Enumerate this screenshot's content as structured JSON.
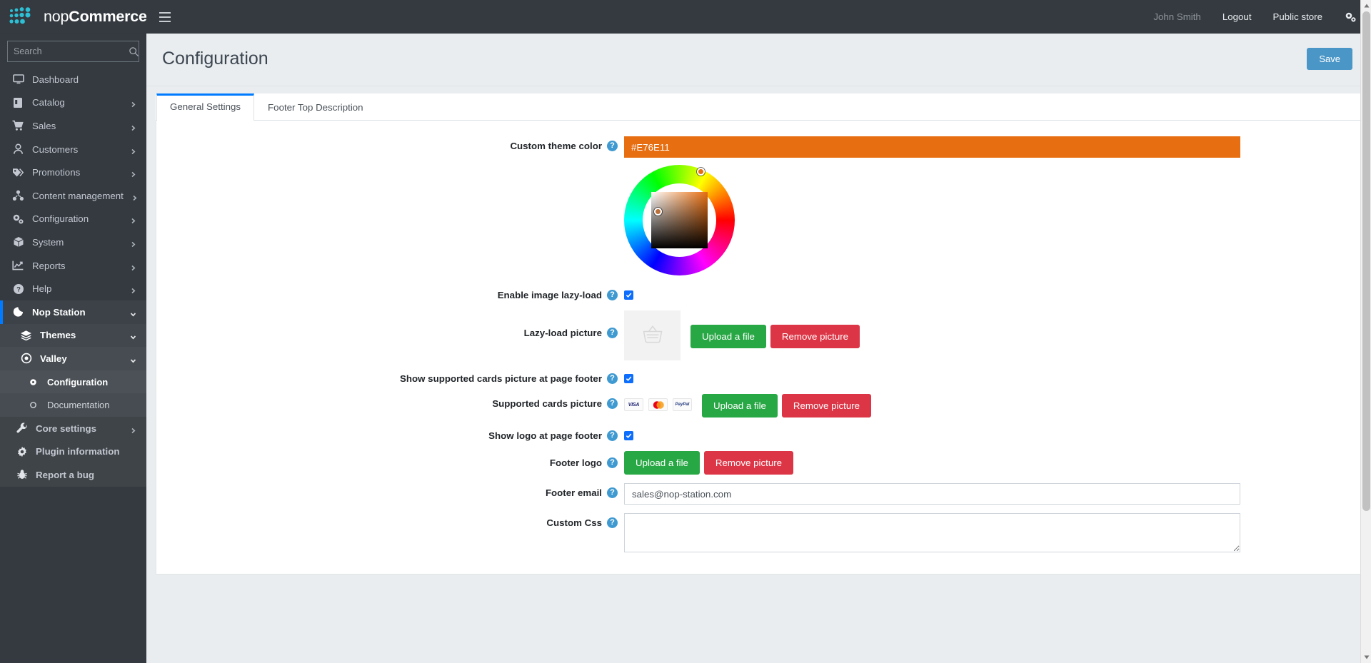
{
  "brand": {
    "name_light": "nop",
    "name_bold": "Commerce",
    "logo_icon": "nopcommerce-dots-logo"
  },
  "search": {
    "placeholder": "Search",
    "value": "",
    "icon": "search-icon"
  },
  "sidebar": {
    "items": [
      {
        "label": "Dashboard",
        "icon": "monitor-icon",
        "has_children": false,
        "level": 1
      },
      {
        "label": "Catalog",
        "icon": "book-icon",
        "has_children": true,
        "level": 1
      },
      {
        "label": "Sales",
        "icon": "shopping-cart-icon",
        "has_children": true,
        "level": 1
      },
      {
        "label": "Customers",
        "icon": "user-icon",
        "has_children": true,
        "level": 1
      },
      {
        "label": "Promotions",
        "icon": "tags-icon",
        "has_children": true,
        "level": 1
      },
      {
        "label": "Content management",
        "icon": "sitemap-icon",
        "has_children": true,
        "level": 1
      },
      {
        "label": "Configuration",
        "icon": "cogs-icon",
        "has_children": true,
        "level": 1
      },
      {
        "label": "System",
        "icon": "cube-icon",
        "has_children": true,
        "level": 1
      },
      {
        "label": "Reports",
        "icon": "chart-line-icon",
        "has_children": true,
        "level": 1
      },
      {
        "label": "Help",
        "icon": "question-circle-icon",
        "has_children": true,
        "level": 1
      },
      {
        "label": "Nop Station",
        "icon": "nop-station-icon",
        "has_children": true,
        "level": 1,
        "active": true
      },
      {
        "label": "Themes",
        "icon": "layers-icon",
        "has_children": true,
        "level": 2
      },
      {
        "label": "Valley",
        "icon": "dot-circle-icon",
        "has_children": true,
        "level": 3
      },
      {
        "label": "Configuration",
        "icon": "circle-small-icon",
        "has_children": false,
        "level": 4,
        "selected": true
      },
      {
        "label": "Documentation",
        "icon": "circle-outline-icon",
        "has_children": false,
        "level": 4
      },
      {
        "label": "Core settings",
        "icon": "wrench-icon",
        "has_children": true,
        "level": 2
      },
      {
        "label": "Plugin information",
        "icon": "gear-icon",
        "has_children": false,
        "level": 2
      },
      {
        "label": "Report a bug",
        "icon": "bug-icon",
        "has_children": false,
        "level": 2
      }
    ]
  },
  "topbar": {
    "menu_toggle_icon": "hamburger-icon",
    "user_name": "John Smith",
    "logout_label": "Logout",
    "public_store_label": "Public store",
    "settings_icon": "cogs-icon"
  },
  "page": {
    "title": "Configuration",
    "save_label": "Save"
  },
  "tabs": [
    {
      "label": "General Settings",
      "active": true
    },
    {
      "label": "Footer Top Description",
      "active": false
    }
  ],
  "form": {
    "theme_color": {
      "label": "Custom theme color",
      "value": "#E76E11",
      "help_icon": "question-circle-icon",
      "picker": {
        "hue_marker_color": "#E76E11",
        "sv_marker_color": "#B9703A"
      }
    },
    "lazy_load_enable": {
      "label": "Enable image lazy-load",
      "checked": true,
      "help_icon": "question-circle-icon"
    },
    "lazy_load_picture": {
      "label": "Lazy-load picture",
      "help_icon": "question-circle-icon",
      "thumb_icon": "basket-placeholder-icon",
      "upload_label": "Upload a file",
      "remove_label": "Remove picture"
    },
    "show_cards_footer": {
      "label": "Show supported cards picture at page footer",
      "checked": true,
      "help_icon": "question-circle-icon"
    },
    "supported_cards_picture": {
      "label": "Supported cards picture",
      "help_icon": "question-circle-icon",
      "cards": [
        {
          "name": "visa-icon",
          "text": "VISA"
        },
        {
          "name": "mastercard-icon",
          "text": ""
        },
        {
          "name": "paypal-icon",
          "text": "PayPal"
        }
      ],
      "upload_label": "Upload a file",
      "remove_label": "Remove picture"
    },
    "show_logo_footer": {
      "label": "Show logo at page footer",
      "checked": true,
      "help_icon": "question-circle-icon"
    },
    "footer_logo": {
      "label": "Footer logo",
      "help_icon": "question-circle-icon",
      "upload_label": "Upload a file",
      "remove_label": "Remove picture"
    },
    "footer_email": {
      "label": "Footer email",
      "value": "sales@nop-station.com",
      "help_icon": "question-circle-icon"
    },
    "custom_css": {
      "label": "Custom Css",
      "value": "",
      "help_icon": "question-circle-icon"
    }
  },
  "colors": {
    "sidebar_bg": "#343A40",
    "accent_blue": "#007BFF",
    "save_blue": "#4A96C7",
    "theme_orange": "#E76E11",
    "green": "#28A745",
    "red": "#DC3545",
    "help_blue": "#3F9AD1"
  }
}
